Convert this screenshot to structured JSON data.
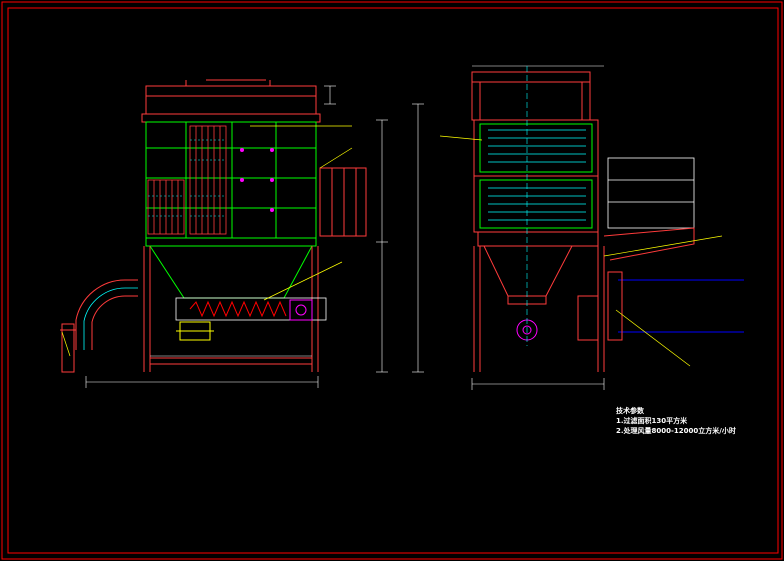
{
  "drawing": {
    "background": "#000000",
    "colors": {
      "frame": "#ff0000",
      "structure": "#ff3b3b",
      "filter": "#00ff00",
      "dimension": "#ffffff",
      "centerline": "#00ffff",
      "auger": "#ff0000",
      "leader": "#ffff00",
      "duct": "#0000ff",
      "motor": "#ff00ff"
    },
    "tech_notes": {
      "title": "技术参数",
      "line1": "1.过滤面积130平方米",
      "line2": "2.处理风量8000-12000立方米/小时"
    }
  }
}
